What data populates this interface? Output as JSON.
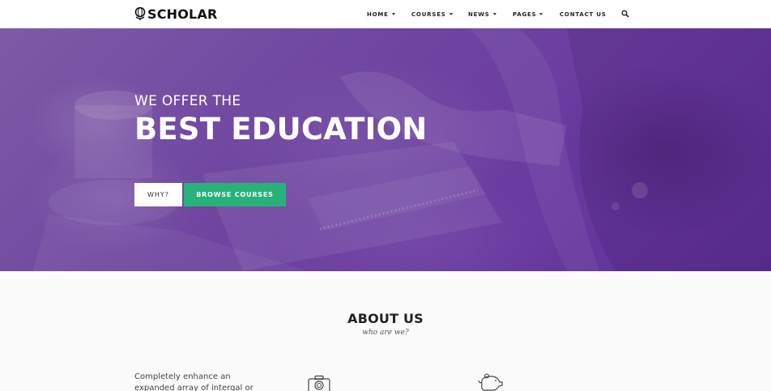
{
  "header": {
    "logo_text": "SCHOLAR",
    "logo_icon": "globe-icon",
    "nav": [
      {
        "label": "HOME",
        "has_dropdown": true
      },
      {
        "label": "COURSES",
        "has_dropdown": true
      },
      {
        "label": "NEWS",
        "has_dropdown": true
      },
      {
        "label": "PAGES",
        "has_dropdown": true
      },
      {
        "label": "CONTACT US",
        "has_dropdown": false
      }
    ],
    "search_icon": "search-icon"
  },
  "hero": {
    "subtitle": "WE OFFER THE",
    "title": "BEST EDUCATION",
    "buttons": {
      "why": "WHY?",
      "browse": "BROWSE COURSES"
    },
    "overlay_color": "#6a3aa0"
  },
  "about": {
    "title": "ABOUT US",
    "subtitle": "who are we?",
    "text": "Completely enhance an expanded array of intergal or",
    "icons": [
      "camera-icon",
      "piggy-bank-icon"
    ]
  },
  "colors": {
    "accent_green": "#28b27a",
    "hero_purple": "#6a3aa0",
    "text_dark": "#222222"
  }
}
